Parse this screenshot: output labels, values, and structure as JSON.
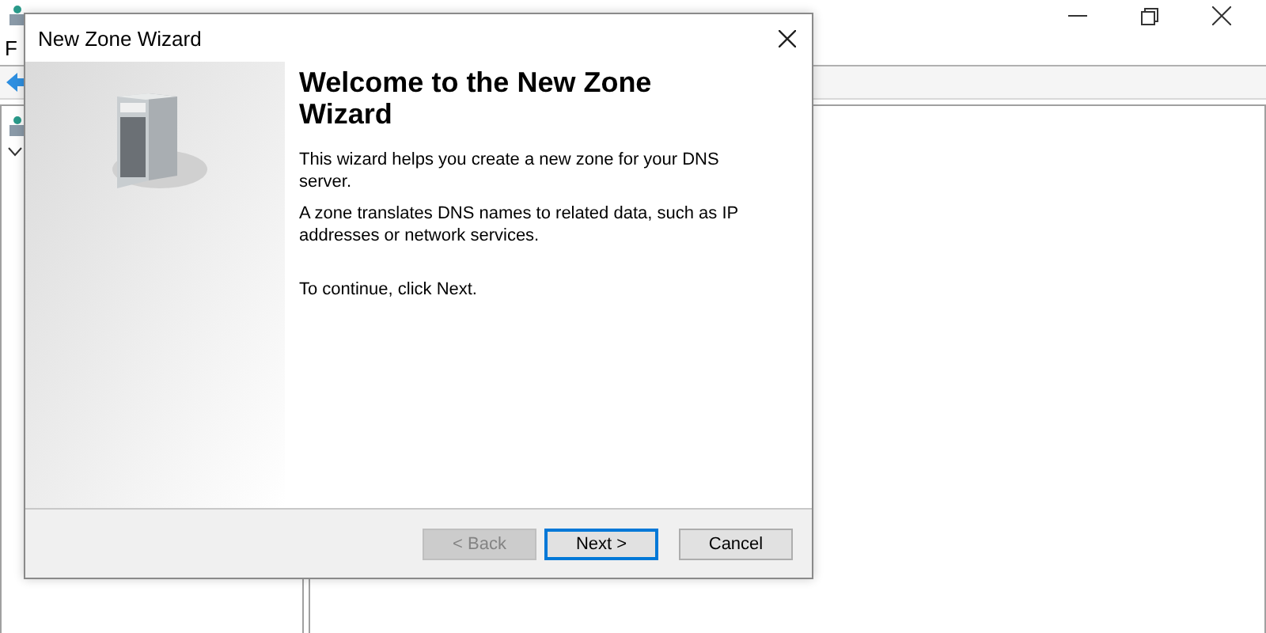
{
  "background_window": {
    "menu": [
      "F"
    ]
  },
  "dialog": {
    "title": "New Zone Wizard",
    "heading": "Welcome to the New Zone Wizard",
    "paragraphs": [
      "This wizard helps you create a new zone for your DNS server.",
      "A zone translates DNS names to related data, such as IP addresses or network services.",
      "To continue, click Next."
    ],
    "buttons": [
      {
        "label": "< Back",
        "disabled": true,
        "selected": false
      },
      {
        "label": "Next >",
        "disabled": false,
        "selected": true
      },
      {
        "label": "Cancel",
        "disabled": false,
        "selected": false
      }
    ]
  }
}
